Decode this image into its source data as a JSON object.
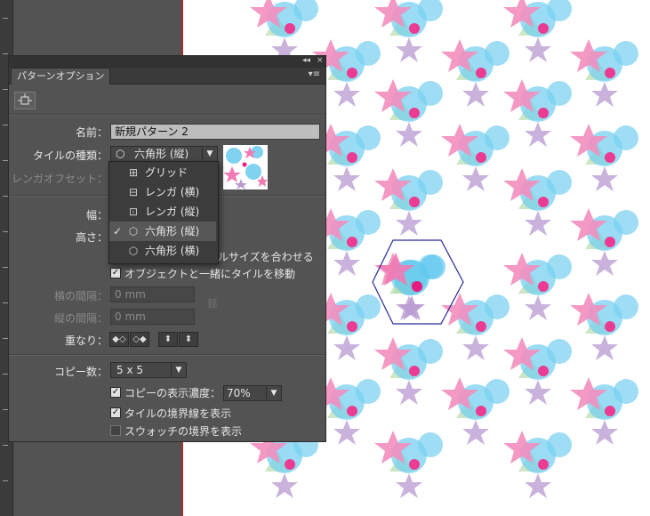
{
  "panel": {
    "title": "パターンオプション",
    "collapse_label": "◂◂",
    "close_label": "×",
    "menu_label": "▾≡"
  },
  "form": {
    "name_label": "名前：",
    "name_value": "新規パターン 2",
    "tile_type_label": "タイルの種類：",
    "tile_type_value": "六角形 (縦)",
    "brick_offset_label": "レンガオフセット：",
    "width_label": "幅：",
    "height_label": "高さ：",
    "size_to_art_label": "イルサイズを合わせる",
    "move_tile_label": "オブジェクトと一緒にタイルを移動",
    "h_spacing_label": "横の間隔：",
    "h_spacing_value": "0 mm",
    "v_spacing_label": "縦の間隔：",
    "v_spacing_value": "0 mm",
    "overlap_label": "重なり：",
    "copies_label": "コピー数：",
    "copies_value": "5 x 5",
    "dim_copies_label": "コピーの表示濃度：",
    "dim_copies_value": "70%",
    "show_tile_edge_label": "タイルの境界線を表示",
    "show_swatch_bounds_label": "スウォッチの境界を表示"
  },
  "tile_menu": {
    "items": [
      {
        "label": "グリッド",
        "icon": "grid-icon",
        "glyph": "⊞",
        "selected": false
      },
      {
        "label": "レンガ (横)",
        "icon": "brick-row-icon",
        "glyph": "⊟",
        "selected": false
      },
      {
        "label": "レンガ (縦)",
        "icon": "brick-column-icon",
        "glyph": "⊡",
        "selected": false
      },
      {
        "label": "六角形 (縦)",
        "icon": "hex-column-icon",
        "glyph": "⬡",
        "selected": true
      },
      {
        "label": "六角形 (横)",
        "icon": "hex-row-icon",
        "glyph": "⬡",
        "selected": false
      }
    ]
  },
  "colors": {
    "pink_star": "#f07ab3",
    "blue_circle": "#5fc8ee",
    "purple_star": "#b99bd0",
    "magenta_dot": "#e8197f",
    "green_triangle": "#b9ddb0",
    "tile_border": "#2a2a9c"
  }
}
